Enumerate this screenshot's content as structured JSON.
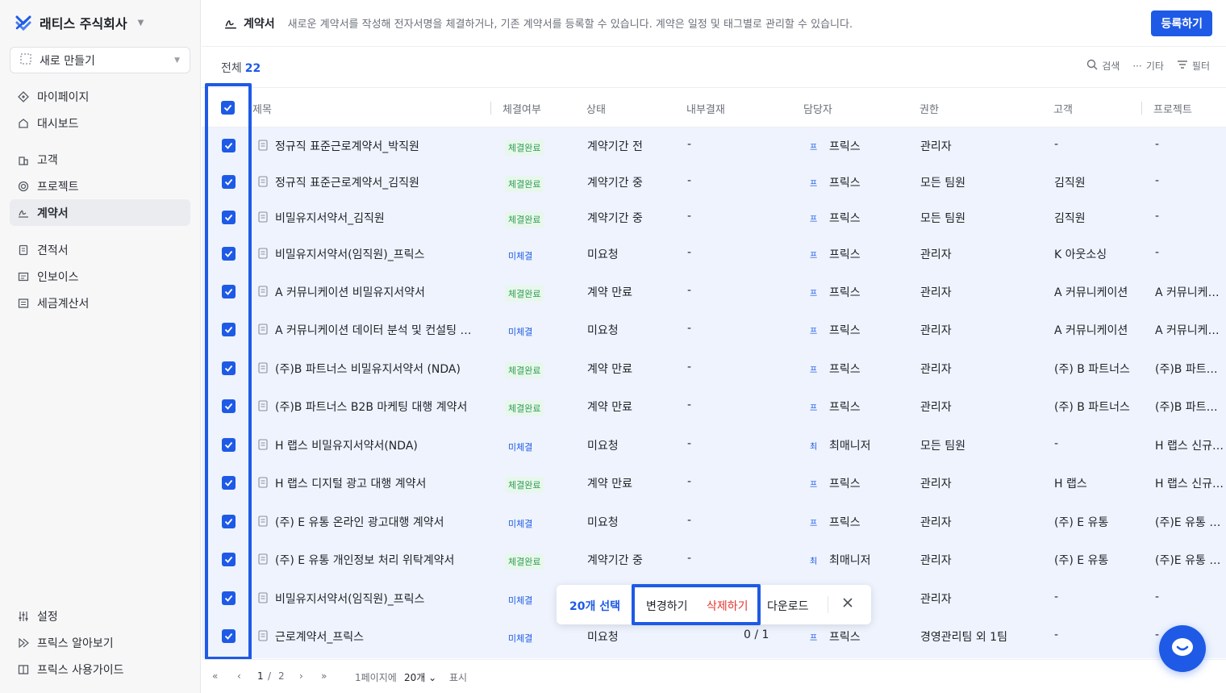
{
  "company": {
    "name": "래티스 주식회사"
  },
  "sidebar": {
    "new_button": "새로 만들기",
    "groups": [
      [
        {
          "label": "마이페이지",
          "icon": "mypage-icon"
        },
        {
          "label": "대시보드",
          "icon": "home-icon"
        }
      ],
      [
        {
          "label": "고객",
          "icon": "building-icon"
        },
        {
          "label": "프로젝트",
          "icon": "target-icon"
        },
        {
          "label": "계약서",
          "icon": "signature-icon",
          "active": true
        }
      ],
      [
        {
          "label": "견적서",
          "icon": "document-icon"
        },
        {
          "label": "인보이스",
          "icon": "invoice-icon"
        },
        {
          "label": "세금계산서",
          "icon": "tax-invoice-icon"
        }
      ]
    ],
    "bottom": [
      {
        "label": "설정",
        "icon": "sliders-icon"
      },
      {
        "label": "프릭스 알아보기",
        "icon": "play-icon"
      },
      {
        "label": "프릭스 사용가이드",
        "icon": "book-icon"
      }
    ]
  },
  "header": {
    "title": "계약서",
    "description": "새로운 계약서를 작성해 전자서명을 체결하거나, 기존 계약서를 등록할 수 있습니다. 계약은 일정 및 태그별로 관리할 수 있습니다.",
    "register_button": "등록하기"
  },
  "toolbar": {
    "total_label": "전체",
    "total_count": "22",
    "search": "검색",
    "more": "기타",
    "filter": "필터"
  },
  "table": {
    "columns": [
      "제목",
      "체결여부",
      "상태",
      "내부결재",
      "담당자",
      "권한",
      "고객",
      "프로젝트"
    ],
    "rows": [
      {
        "title": "정규직 표준근로계약서_박직원",
        "signed": "체결완료",
        "signed_state": "done",
        "status": "계약기간 전",
        "approval": "-",
        "avatar": "프",
        "owner": "프릭스",
        "permission": "관리자",
        "client": "-",
        "project": "-"
      },
      {
        "title": "정규직 표준근로계약서_김직원",
        "signed": "체결완료",
        "signed_state": "done",
        "status": "계약기간 중",
        "approval": "-",
        "avatar": "프",
        "owner": "프릭스",
        "permission": "모든 팀원",
        "client": "김직원",
        "project": "-"
      },
      {
        "title": "비밀유지서약서_김직원",
        "signed": "체결완료",
        "signed_state": "done",
        "status": "계약기간 중",
        "approval": "-",
        "avatar": "프",
        "owner": "프릭스",
        "permission": "모든 팀원",
        "client": "김직원",
        "project": "-"
      },
      {
        "title": "비밀유지서약서(임직원)_프릭스",
        "signed": "미체결",
        "signed_state": "none",
        "status": "미요청",
        "approval": "-",
        "avatar": "프",
        "owner": "프릭스",
        "permission": "관리자",
        "client": "K 아웃소싱",
        "project": "-"
      },
      {
        "title": "A 커뮤니케이션 비밀유지서약서",
        "signed": "체결완료",
        "signed_state": "done",
        "status": "계약 만료",
        "approval": "-",
        "avatar": "프",
        "owner": "프릭스",
        "permission": "관리자",
        "client": "A 커뮤니케이션",
        "project": "A 커뮤니케이..."
      },
      {
        "title": "A 커뮤니케이션 데이터 분석 및 컨설팅 계...",
        "signed": "미체결",
        "signed_state": "none",
        "status": "미요청",
        "approval": "-",
        "avatar": "프",
        "owner": "프릭스",
        "permission": "관리자",
        "client": "A 커뮤니케이션",
        "project": "A 커뮤니케이..."
      },
      {
        "title": "(주)B 파트너스 비밀유지서약서 (NDA)",
        "signed": "체결완료",
        "signed_state": "done",
        "status": "계약 만료",
        "approval": "-",
        "avatar": "프",
        "owner": "프릭스",
        "permission": "관리자",
        "client": "(주) B 파트너스",
        "project": "(주)B 파트너..."
      },
      {
        "title": "(주)B 파트너스 B2B 마케팅 대행 계약서",
        "signed": "체결완료",
        "signed_state": "done",
        "status": "계약 만료",
        "approval": "-",
        "avatar": "프",
        "owner": "프릭스",
        "permission": "관리자",
        "client": "(주) B 파트너스",
        "project": "(주)B 파트너..."
      },
      {
        "title": "H 랩스 비밀유지서약서(NDA)",
        "signed": "미체결",
        "signed_state": "none",
        "status": "미요청",
        "approval": "-",
        "avatar": "최",
        "owner": "최매니저",
        "permission": "모든 팀원",
        "client": "-",
        "project": "H 랩스 신규 서..."
      },
      {
        "title": "H 랩스 디지털 광고 대행 계약서",
        "signed": "체결완료",
        "signed_state": "done",
        "status": "계약 만료",
        "approval": "-",
        "avatar": "프",
        "owner": "프릭스",
        "permission": "관리자",
        "client": "H 랩스",
        "project": "H 랩스 신규 서..."
      },
      {
        "title": "(주) E 유통 온라인 광고대행 계약서",
        "signed": "미체결",
        "signed_state": "none",
        "status": "미요청",
        "approval": "-",
        "avatar": "프",
        "owner": "프릭스",
        "permission": "관리자",
        "client": "(주) E 유통",
        "project": "(주)E 유통 분..."
      },
      {
        "title": "(주) E 유통 개인정보 처리 위탁계약서",
        "signed": "체결완료",
        "signed_state": "done",
        "status": "계약기간 중",
        "approval": "-",
        "avatar": "최",
        "owner": "최매니저",
        "permission": "관리자",
        "client": "(주) E 유통",
        "project": "(주)E 유통 분..."
      },
      {
        "title": "비밀유지서약서(임직원)_프릭스",
        "signed": "미체결",
        "signed_state": "none",
        "status": "",
        "approval": "",
        "avatar": "",
        "owner": "",
        "permission": "관리자",
        "client": "-",
        "project": "-"
      },
      {
        "title": "근로계약서_프릭스",
        "signed": "미체결",
        "signed_state": "none",
        "status": "미요청",
        "approval": "0 / 1",
        "avatar": "프",
        "owner": "프릭스",
        "permission": "경영관리팀 외 1팀",
        "client": "-",
        "project": "-"
      }
    ]
  },
  "pagination": {
    "current": "1",
    "separator": "/",
    "total": "2",
    "per_page_label": "1페이지에",
    "per_page_value": "20개",
    "show_label": "표시"
  },
  "action_bar": {
    "selected": "20개 선택",
    "edit": "변경하기",
    "delete": "삭제하기",
    "download": "다운로드"
  },
  "colors": {
    "accent": "#1e5ae6",
    "danger": "#e5342f",
    "success": "#2f9d52",
    "selected_row_bg": "#eef3fd"
  }
}
